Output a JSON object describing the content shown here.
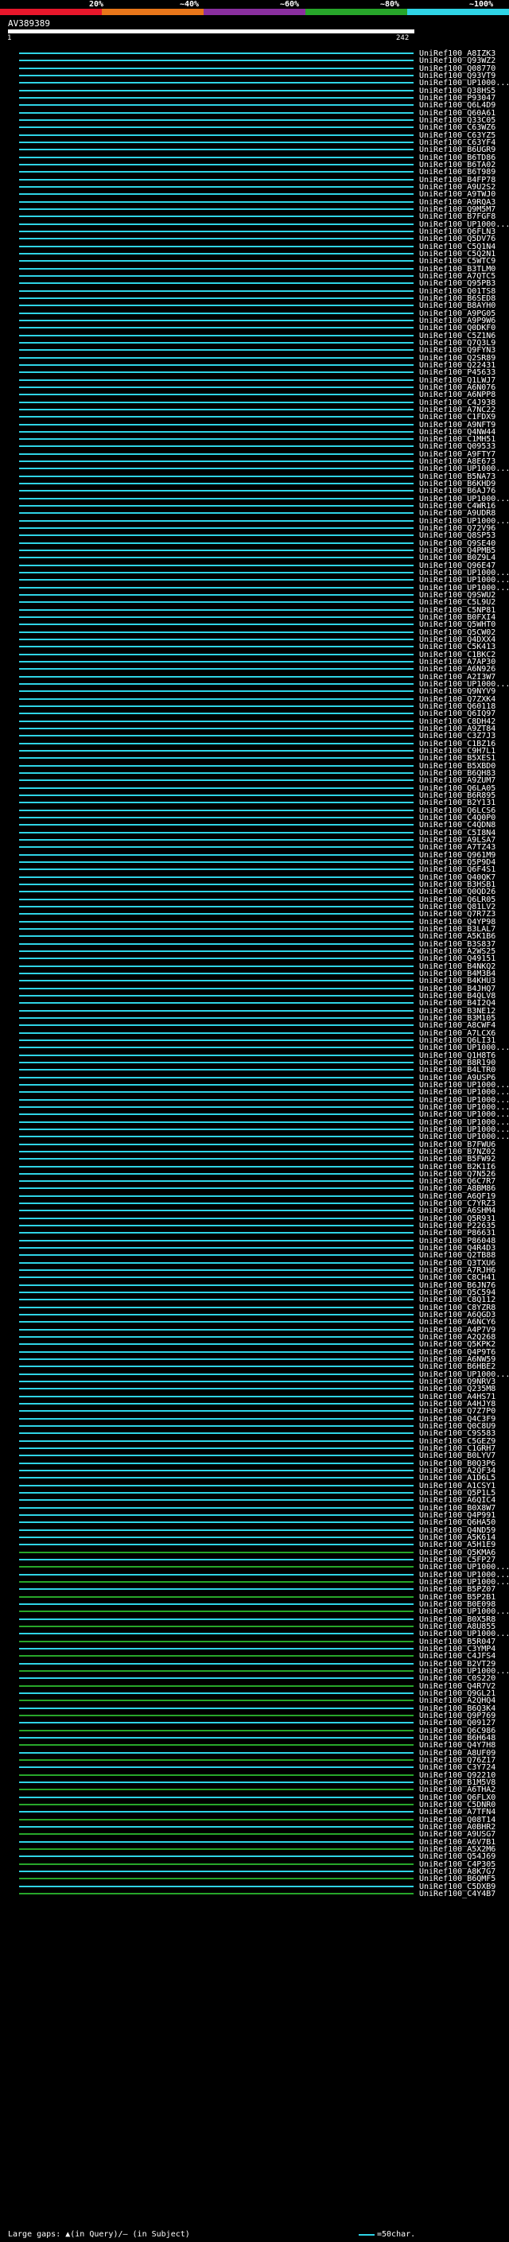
{
  "legend": [
    {
      "label": "20%",
      "color": "#e8172b"
    },
    {
      "label": "~40%",
      "color": "#e8761a"
    },
    {
      "label": "~60%",
      "color": "#8a2f9f"
    },
    {
      "label": "~80%",
      "color": "#27a62a"
    },
    {
      "label": "~100%",
      "color": "#2fd4e6"
    }
  ],
  "query": {
    "id": "AV389389",
    "start": "1",
    "end": "242"
  },
  "hits": [
    "UniRef100_A8IZK3",
    "UniRef100_Q93WZ2",
    "UniRef100_Q08770",
    "UniRef100_Q93VT9",
    "UniRef100_UP1000...",
    "UniRef100_Q38HS5",
    "UniRef100_P93047",
    "UniRef100_Q6L4D9",
    "UniRef100_Q60A61",
    "UniRef100_Q33C05",
    "UniRef100_C63WZ6",
    "UniRef100_C63YZ5",
    "UniRef100_C63YF4",
    "UniRef100_B6UGR9",
    "UniRef100_B6TD86",
    "UniRef100_B6TA02",
    "UniRef100_B6T989",
    "UniRef100_B4FP78",
    "UniRef100_A9U2S2",
    "UniRef100_A9TWJ0",
    "UniRef100_A9RQA3",
    "UniRef100_Q9M5M7",
    "UniRef100_B7FGF8",
    "UniRef100_UP1000...",
    "UniRef100_Q6FLN3",
    "UniRef100_Q5DV76",
    "UniRef100_C5Q1N4",
    "UniRef100_C5Q2N1",
    "UniRef100_C5WTC9",
    "UniRef100_B3TLM0",
    "UniRef100_A7QTC5",
    "UniRef100_Q95PB3",
    "UniRef100_Q01TS8",
    "UniRef100_B6SED8",
    "UniRef100_B8AYH0",
    "UniRef100_A9PG05",
    "UniRef100_A9P9W6",
    "UniRef100_Q0DKF0",
    "UniRef100_C5Z1N6",
    "UniRef100_Q7Q3L9",
    "UniRef100_Q9FYN3",
    "UniRef100_Q2SR89",
    "UniRef100_Q22431",
    "UniRef100_P45633",
    "UniRef100_Q1LWJ7",
    "UniRef100_A6N076",
    "UniRef100_A6NPP8",
    "UniRef100_C4J938",
    "UniRef100_A7NC22",
    "UniRef100_C1FDX9",
    "UniRef100_A9NFT9",
    "UniRef100_Q4NW44",
    "UniRef100_C1MH51",
    "UniRef100_Q09533",
    "UniRef100_A9FTY7",
    "UniRef100_A8E673",
    "UniRef100_UP1000...",
    "UniRef100_B5NA73",
    "UniRef100_B6KHD9",
    "UniRef100_B6AJ76",
    "UniRef100_UP1000...",
    "UniRef100_C4WR16",
    "UniRef100_A9UDR8",
    "UniRef100_UP1000...",
    "UniRef100_Q72V96",
    "UniRef100_Q8SP53",
    "UniRef100_Q9SE40",
    "UniRef100_Q4PMB5",
    "UniRef100_B0Z9L4",
    "UniRef100_Q96E47",
    "UniRef100_UP1000...",
    "UniRef100_UP1000...",
    "UniRef100_UP1000...",
    "UniRef100_Q9SWU2",
    "UniRef100_C5L9U2",
    "UniRef100_C5NP81",
    "UniRef100_B0FXI4",
    "UniRef100_Q5WHT0",
    "UniRef100_Q5CW02",
    "UniRef100_Q4DXX4",
    "UniRef100_C5K413",
    "UniRef100_C1BKC2",
    "UniRef100_A7AP30",
    "UniRef100_A6N926",
    "UniRef100_A2I3W7",
    "UniRef100_UP1000...",
    "UniRef100_Q9NYV9",
    "UniRef100_Q7ZXK4",
    "UniRef100_Q60118",
    "UniRef100_Q6IQ97",
    "UniRef100_C8DH42",
    "UniRef100_A9ZT84",
    "UniRef100_C3Z7J3",
    "UniRef100_C1BZ16",
    "UniRef100_C9H7L1",
    "UniRef100_B5XES1",
    "UniRef100_B5XBD0",
    "UniRef100_B6QH83",
    "UniRef100_A9ZUM7",
    "UniRef100_Q6LA05",
    "UniRef100_B6R895",
    "UniRef100_B2Y131",
    "UniRef100_Q6LCS6",
    "UniRef100_C4Q0P0",
    "UniRef100_C4QDN8",
    "UniRef100_C5I8N4",
    "UniRef100_A9LSA7",
    "UniRef100_A7TZ43",
    "UniRef100_Q961M9",
    "UniRef100_Q5P9D4",
    "UniRef100_Q6F4S1",
    "UniRef100_Q40QK7",
    "UniRef100_B3HSB1",
    "UniRef100_Q0QD26",
    "UniRef100_Q6LR05",
    "UniRef100_Q81LV2",
    "UniRef100_Q7R7Z3",
    "UniRef100_Q4YP98",
    "UniRef100_B3LAL7",
    "UniRef100_A5K1B6",
    "UniRef100_B3S837",
    "UniRef100_A2WS25",
    "UniRef100_Q49151",
    "UniRef100_B4NKQ2",
    "UniRef100_B4M3B4",
    "UniRef100_B4KHU3",
    "UniRef100_B4JHQ7",
    "UniRef100_B4QLV8",
    "UniRef100_B4I2Q4",
    "UniRef100_B3NE12",
    "UniRef100_B3M105",
    "UniRef100_A8CWF4",
    "UniRef100_A7LCX6",
    "UniRef100_Q6LI31",
    "UniRef100_UP1000...",
    "UniRef100_Q1H8T6",
    "UniRef100_B8R190",
    "UniRef100_B4LTR0",
    "UniRef100_A9USP6",
    "UniRef100_UP1000...",
    "UniRef100_UP1000...",
    "UniRef100_UP1000...",
    "UniRef100_UP1000...",
    "UniRef100_UP1000...",
    "UniRef100_UP1000...",
    "UniRef100_UP1000...",
    "UniRef100_UP1000...",
    "UniRef100_B7FWU6",
    "UniRef100_B7NZ02",
    "UniRef100_B5FW92",
    "UniRef100_B2K1I6",
    "UniRef100_Q7N526",
    "UniRef100_Q6C7R7",
    "UniRef100_A8BM86",
    "UniRef100_A6QF19",
    "UniRef100_C7YRZ3",
    "UniRef100_A6SHM4",
    "UniRef100_Q5R931",
    "UniRef100_P22635",
    "UniRef100_P86631",
    "UniRef100_P86048",
    "UniRef100_Q4R4D3",
    "UniRef100_Q2TB88",
    "UniRef100_Q3TXU6",
    "UniRef100_A7RJH6",
    "UniRef100_C8CH41",
    "UniRef100_B6JN76",
    "UniRef100_Q5C594",
    "UniRef100_C8Q112",
    "UniRef100_C8YZR8",
    "UniRef100_A6QGD3",
    "UniRef100_A6NCY6",
    "UniRef100_A4P7V9",
    "UniRef100_A2Q268",
    "UniRef100_Q5KPK2",
    "UniRef100_Q4P9T6",
    "UniRef100_A6NW59",
    "UniRef100_B6HBE2",
    "UniRef100_UP1000...",
    "UniRef100_Q9NRV3",
    "UniRef100_Q235M8",
    "UniRef100_A4HS71",
    "UniRef100_A4HJY8",
    "UniRef100_Q7Z7P0",
    "UniRef100_Q4C3F9",
    "UniRef100_Q0C8U9",
    "UniRef100_C9S583",
    "UniRef100_C5GEZ9",
    "UniRef100_C1GRH7",
    "UniRef100_B0LYV7",
    "UniRef100_B0Q3P6",
    "UniRef100_A2QF34",
    "UniRef100_A1D6L5",
    "UniRef100_A1CSY1",
    "UniRef100_Q5P1L5",
    "UniRef100_A6QIC4",
    "UniRef100_B0X8W7",
    "UniRef100_Q4P991",
    "UniRef100_Q6HA50",
    "UniRef100_Q4ND59",
    "UniRef100_A5K614",
    "UniRef100_A5H1E9",
    "UniRef100_Q5KMA6",
    "UniRef100_C5FP27",
    "UniRef100_UP1000...",
    "UniRef100_UP1000...",
    "UniRef100_UP1000...",
    "UniRef100_B5PZ07",
    "UniRef100_B5P2B1",
    "UniRef100_B0E098",
    "UniRef100_UP1000...",
    "UniRef100_B0X5R8",
    "UniRef100_A8U855",
    "UniRef100_UP1000...",
    "UniRef100_B5R047",
    "UniRef100_C3YMP4",
    "UniRef100_C4JFS4",
    "UniRef100_B2VT29",
    "UniRef100_UP1000...",
    "UniRef100_C0S220",
    "UniRef100_Q4R7V2",
    "UniRef100_Q9GL21",
    "UniRef100_A2QHQ4",
    "UniRef100_B6Q3K4",
    "UniRef100_Q9P769",
    "UniRef100_Q09127",
    "UniRef100_Q6C986",
    "UniRef100_B6H648",
    "UniRef100_Q4Y7H8",
    "UniRef100_A8UF09",
    "UniRef100_Q76Z17",
    "UniRef100_C3Y724",
    "UniRef100_Q92210",
    "UniRef100_B1M5V8",
    "UniRef100_A6THA2",
    "UniRef100_Q6FLX0",
    "UniRef100_C5DNR0",
    "UniRef100_A7TFN4",
    "UniRef100_Q08T14",
    "UniRef100_A0BHR2",
    "UniRef100_A9USG7",
    "UniRef100_A6V7B1",
    "UniRef100_A5X2M6",
    "UniRef100_Q54J69",
    "UniRef100_C4P305",
    "UniRef100_A8K7G7",
    "UniRef100_B6QMF5",
    "UniRef100_C5DXB9",
    "UniRef100_C4Y4B7"
  ],
  "footer": {
    "gaps_label": "Large gaps: ▲(in Query)/– (in Subject)",
    "scale_label": "=50char."
  }
}
